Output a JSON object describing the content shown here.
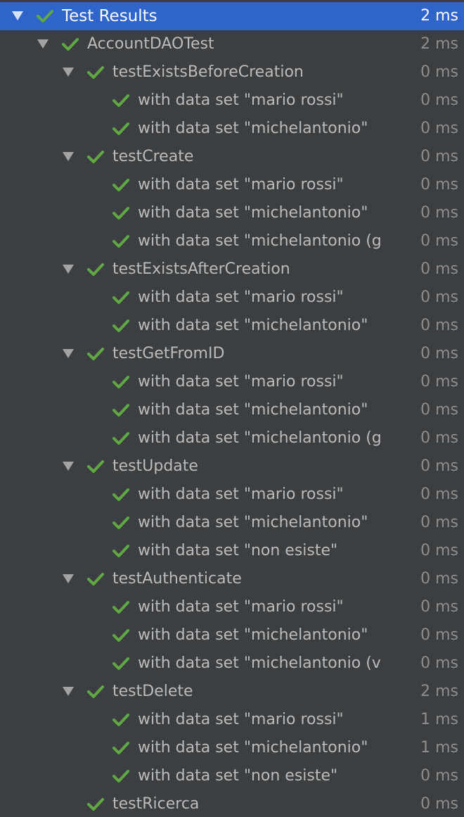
{
  "colors": {
    "background": "#3c3f41",
    "selection": "#2f65ca",
    "check": "#5fa843",
    "text": "#bbbbbb",
    "duration": "#8e8e8e"
  },
  "icons": {
    "expand": "chevron-down-icon",
    "status": "check-icon"
  },
  "rows": [
    {
      "level": 0,
      "expanded": true,
      "label": "Test Results",
      "time": "2 ms",
      "selected": true
    },
    {
      "level": 1,
      "expanded": true,
      "label": "AccountDAOTest",
      "time": "2 ms"
    },
    {
      "level": 2,
      "expanded": true,
      "label": "testExistsBeforeCreation",
      "time": "0 ms"
    },
    {
      "level": 3,
      "label": "with data set \"mario rossi\"",
      "time": "0 ms"
    },
    {
      "level": 3,
      "label": "with data set \"michelantonio\"",
      "time": "0 ms"
    },
    {
      "level": 2,
      "expanded": true,
      "label": "testCreate",
      "time": "0 ms"
    },
    {
      "level": 3,
      "label": "with data set \"mario rossi\"",
      "time": "0 ms"
    },
    {
      "level": 3,
      "label": "with data set \"michelantonio\"",
      "time": "0 ms"
    },
    {
      "level": 3,
      "label": "with data set \"michelantonio (g",
      "time": "0 ms"
    },
    {
      "level": 2,
      "expanded": true,
      "label": "testExistsAfterCreation",
      "time": "0 ms"
    },
    {
      "level": 3,
      "label": "with data set \"mario rossi\"",
      "time": "0 ms"
    },
    {
      "level": 3,
      "label": "with data set \"michelantonio\"",
      "time": "0 ms"
    },
    {
      "level": 2,
      "expanded": true,
      "label": "testGetFromID",
      "time": "0 ms"
    },
    {
      "level": 3,
      "label": "with data set \"mario rossi\"",
      "time": "0 ms"
    },
    {
      "level": 3,
      "label": "with data set \"michelantonio\"",
      "time": "0 ms"
    },
    {
      "level": 3,
      "label": "with data set \"michelantonio (g",
      "time": "0 ms"
    },
    {
      "level": 2,
      "expanded": true,
      "label": "testUpdate",
      "time": "0 ms"
    },
    {
      "level": 3,
      "label": "with data set \"mario rossi\"",
      "time": "0 ms"
    },
    {
      "level": 3,
      "label": "with data set \"michelantonio\"",
      "time": "0 ms"
    },
    {
      "level": 3,
      "label": "with data set \"non esiste\"",
      "time": "0 ms"
    },
    {
      "level": 2,
      "expanded": true,
      "label": "testAuthenticate",
      "time": "0 ms"
    },
    {
      "level": 3,
      "label": "with data set \"mario rossi\"",
      "time": "0 ms"
    },
    {
      "level": 3,
      "label": "with data set \"michelantonio\"",
      "time": "0 ms"
    },
    {
      "level": 3,
      "label": "with data set \"michelantonio (v",
      "time": "0 ms"
    },
    {
      "level": 2,
      "expanded": true,
      "label": "testDelete",
      "time": "2 ms"
    },
    {
      "level": 3,
      "label": "with data set \"mario rossi\"",
      "time": "1 ms"
    },
    {
      "level": 3,
      "label": "with data set \"michelantonio\"",
      "time": "1 ms"
    },
    {
      "level": 3,
      "label": "with data set \"non esiste\"",
      "time": "0 ms"
    },
    {
      "level": 2,
      "label": "testRicerca",
      "time": "0 ms"
    }
  ]
}
